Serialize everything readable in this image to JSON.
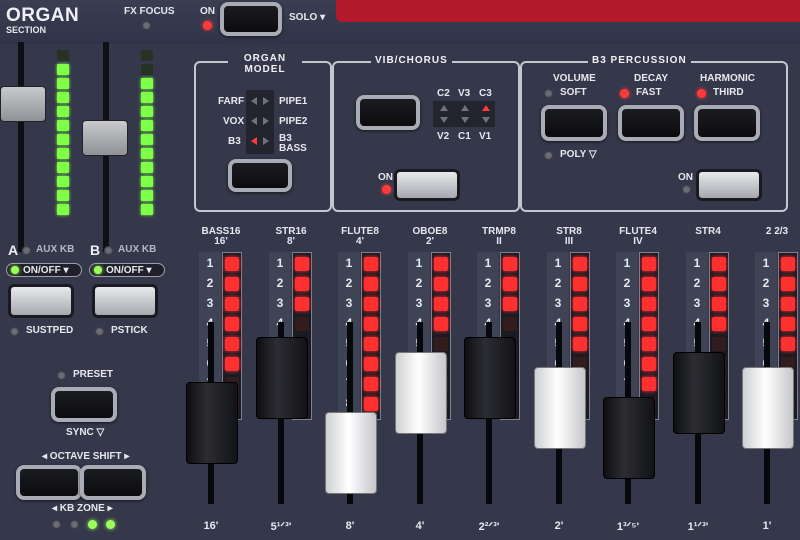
{
  "header": {
    "title": "ORGAN",
    "subtitle": "SECTION",
    "fx_focus": "FX FOCUS",
    "on": "ON",
    "solo": "SOLO ▾"
  },
  "organ_model": {
    "title": "ORGAN MODEL",
    "left": [
      "FARF",
      "VOX",
      "B3"
    ],
    "right": [
      "PIPE1",
      "PIPE2",
      "B3 BASS"
    ],
    "selected": "B3"
  },
  "vib_chorus": {
    "title": "VIB/CHORUS",
    "top": [
      "C2",
      "V3",
      "C3"
    ],
    "bottom": [
      "V2",
      "C1",
      "V1"
    ],
    "selected": "C3",
    "on": "ON",
    "on_active": true
  },
  "percussion": {
    "title": "B3 PERCUSSION",
    "volume": "VOLUME",
    "soft": "SOFT",
    "soft_active": false,
    "decay": "DECAY",
    "fast": "FAST",
    "fast_active": true,
    "harmonic": "HARMONIC",
    "third": "THIRD",
    "third_active": true,
    "poly": "POLY ▽",
    "on": "ON",
    "on_active": false
  },
  "left_controls": {
    "a_label": "A",
    "a_aux": "AUX KB",
    "b_label": "B",
    "b_aux": "AUX KB",
    "onoff": "ON/OFF ▾",
    "sustped": "SUSTPED",
    "pstick": "PSTICK",
    "preset": "PRESET",
    "sync": "SYNC ▽",
    "octave_shift": "◂ OCTAVE SHIFT ▸",
    "kb_zone": "◂ KB ZONE ▸"
  },
  "meters": {
    "left_level": 0.62,
    "right_level": 0.55
  },
  "drawbars": [
    {
      "name": "BASS16",
      "sub": "16'",
      "foot": "16'",
      "leds": 6,
      "count": 8,
      "style": "dark",
      "position": 6
    },
    {
      "name": "STR16",
      "sub": "8'",
      "foot": "5¹ᐟ³'",
      "leds": 3,
      "count": 8,
      "style": "dark",
      "position": 3
    },
    {
      "name": "FLUTE8",
      "sub": "4'",
      "foot": "8'",
      "leds": 8,
      "count": 8,
      "style": "white",
      "position": 8
    },
    {
      "name": "OBOE8",
      "sub": "2'",
      "foot": "4'",
      "leds": 4,
      "count": 8,
      "style": "white",
      "position": 4
    },
    {
      "name": "TRMP8",
      "sub": "II",
      "foot": "2²ᐟ³'",
      "leds": 3,
      "count": 8,
      "style": "dark",
      "position": 3
    },
    {
      "name": "STR8",
      "sub": "III",
      "foot": "2'",
      "leds": 5,
      "count": 8,
      "style": "white",
      "position": 5
    },
    {
      "name": "FLUTE4",
      "sub": "IV",
      "foot": "1³ᐟ⁵'",
      "leds": 7,
      "count": 8,
      "style": "dark",
      "position": 7
    },
    {
      "name": "STR4",
      "sub": "",
      "foot": "1¹ᐟ³'",
      "leds": 4,
      "count": 8,
      "style": "dark",
      "position": 4
    },
    {
      "name": "2 2/3",
      "sub": "",
      "foot": "1'",
      "leds": 5,
      "count": 8,
      "style": "white",
      "position": 5
    }
  ],
  "kb_zone_leds": [
    "off",
    "off",
    "green",
    "green"
  ]
}
